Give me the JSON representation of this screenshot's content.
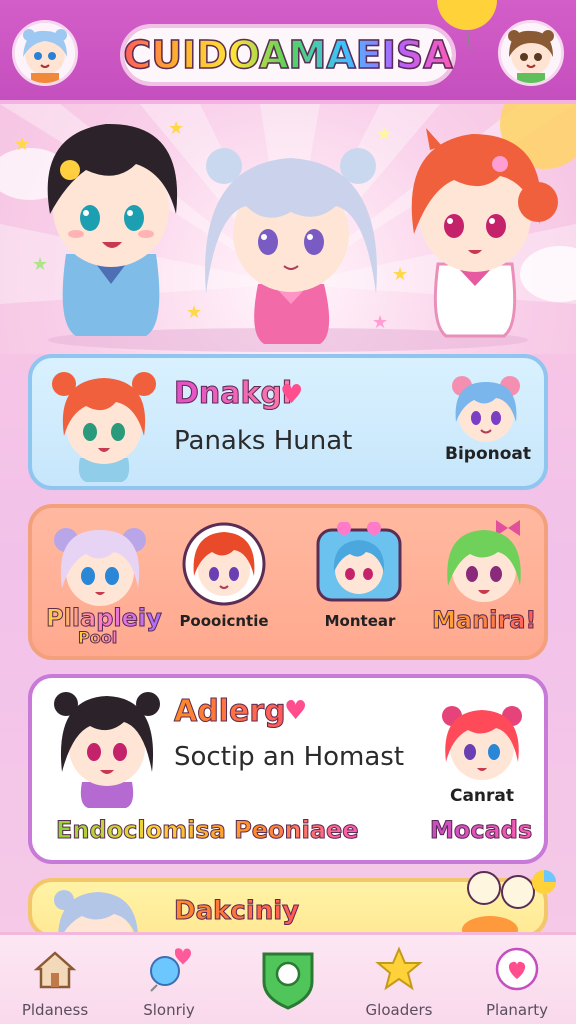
{
  "header": {
    "title": "CUIDOAMAEISA",
    "left_avatar": "blue-haired-chibi-avatar",
    "right_avatar": "brown-haired-chibi-avatar"
  },
  "cards": {
    "card1": {
      "title": "Dnakgl",
      "subtitle": "Panaks Hunat",
      "side_label": "Biponoat"
    },
    "card2": {
      "items": [
        {
          "label_top": "Pllapleiy",
          "label_bottom": "Pool"
        },
        {
          "label_top": "Poooicntie"
        },
        {
          "label_top": "Montear"
        },
        {
          "label_top": "Manira!"
        }
      ]
    },
    "card3": {
      "title": "Adlerg",
      "subtitle": "Soctip an Homast",
      "side_label": "Canrat",
      "footer_left": "Endoclomisa Peoniaee",
      "footer_right": "Mocads"
    },
    "card4": {
      "title": "Dakciniy"
    }
  },
  "nav": {
    "items": [
      {
        "label": "Pldaness",
        "icon": "house-icon"
      },
      {
        "label": "Slonriy",
        "icon": "heart-balloon-icon"
      },
      {
        "label": "",
        "icon": "map-pin-icon"
      },
      {
        "label": "Gloaders",
        "icon": "star-icon"
      },
      {
        "label": "Planarty",
        "icon": "heart-circle-icon"
      }
    ]
  },
  "colors": {
    "header": "#c44fbe",
    "card1": "#c7e6fb",
    "card2": "#ffa98f",
    "card3": "#ffffff",
    "card4": "#ffe995",
    "accent": "#ff4d8d"
  }
}
